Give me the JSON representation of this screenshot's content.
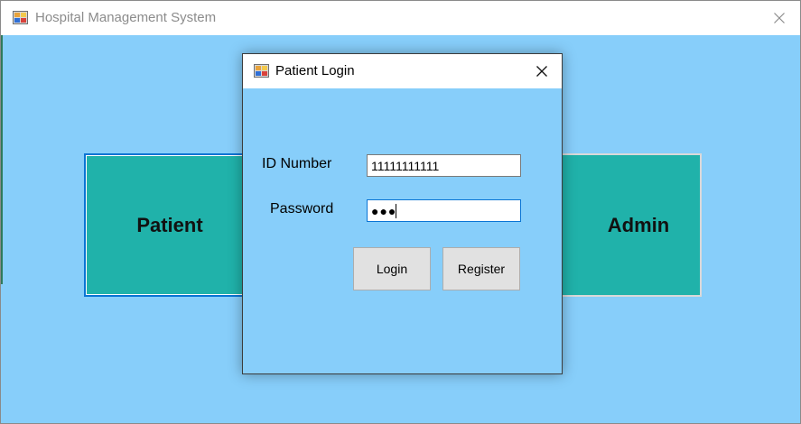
{
  "main_window": {
    "title": "Hospital Management System",
    "icon": "app-window-icon",
    "close_icon": "close-icon"
  },
  "role_buttons": {
    "patient_label": "Patient",
    "admin_label": "Admin"
  },
  "login_dialog": {
    "title": "Patient Login",
    "icon": "app-window-icon",
    "close_icon": "close-icon",
    "id_label": "ID Number",
    "id_value": "11111111111",
    "password_label": "Password",
    "password_mask": "●●●",
    "login_label": "Login",
    "register_label": "Register"
  },
  "colors": {
    "background": "#87cefa",
    "role_button": "#20b2aa",
    "focus_border": "#0a74d4",
    "push_button": "#e1e1e1"
  }
}
